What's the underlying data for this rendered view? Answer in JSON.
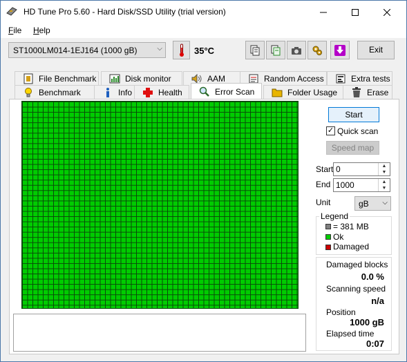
{
  "window": {
    "title": "HD Tune Pro 5.60 - Hard Disk/SSD Utility (trial version)"
  },
  "menu": {
    "file_prefix": "F",
    "file_rest": "ile",
    "help_prefix": "H",
    "help_rest": "elp"
  },
  "toolbar": {
    "drive": "ST1000LM014-1EJ164 (1000 gB)",
    "temperature": "35°C",
    "exit_label": "Exit"
  },
  "tabs": {
    "row1": [
      "File Benchmark",
      "Disk monitor",
      "AAM",
      "Random Access",
      "Extra tests"
    ],
    "row2": [
      "Benchmark",
      "Info",
      "Health",
      "Error Scan",
      "Folder Usage",
      "Erase"
    ],
    "active": "Error Scan"
  },
  "scan": {
    "start_label": "Start",
    "quick_scan_label": "Quick scan",
    "quick_scan_checked": true,
    "speed_map_label": "Speed map",
    "start_field_label": "Start",
    "start_value": "0",
    "end_field_label": "End",
    "end_value": "1000",
    "unit_label": "Unit",
    "unit_value": "gB",
    "grid_fill_fraction": 1.0,
    "grid_color": "#00cc00"
  },
  "legend": {
    "title": "Legend",
    "block_size": "= 381 MB",
    "ok": "Ok",
    "damaged": "Damaged",
    "colors": {
      "block": "#808080",
      "ok": "#00cc00",
      "damaged": "#cc0000"
    }
  },
  "stats": {
    "damaged_label": "Damaged blocks",
    "damaged_value": "0.0 %",
    "speed_label": "Scanning speed",
    "speed_value": "n/a",
    "position_label": "Position",
    "position_value": "1000 gB",
    "elapsed_label": "Elapsed time",
    "elapsed_value": "0:07"
  }
}
